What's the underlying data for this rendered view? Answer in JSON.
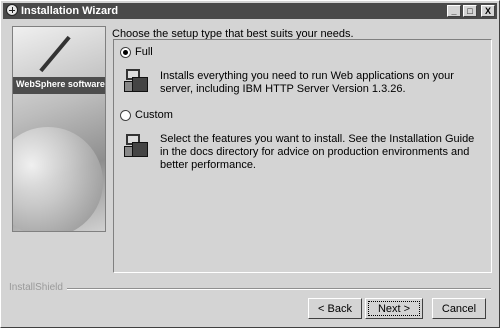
{
  "window": {
    "title": "Installation Wizard"
  },
  "titlebar_buttons": {
    "minimize": "_",
    "maximize": "□",
    "close": "X"
  },
  "side_image": {
    "brand": "WebSphere software"
  },
  "prompt": "Choose the setup type that best suits your needs.",
  "options": [
    {
      "label": "Full",
      "checked": true,
      "description": "Installs everything you need to run Web applications on your server, including IBM HTTP Server Version 1.3.26."
    },
    {
      "label": "Custom",
      "checked": false,
      "description": "Select the features you want to install.  See the Installation Guide in the docs directory for advice on production environments and better performance."
    }
  ],
  "footer": {
    "brand": "InstallShield"
  },
  "buttons": {
    "back": "< Back",
    "next": "Next >",
    "cancel": "Cancel"
  }
}
